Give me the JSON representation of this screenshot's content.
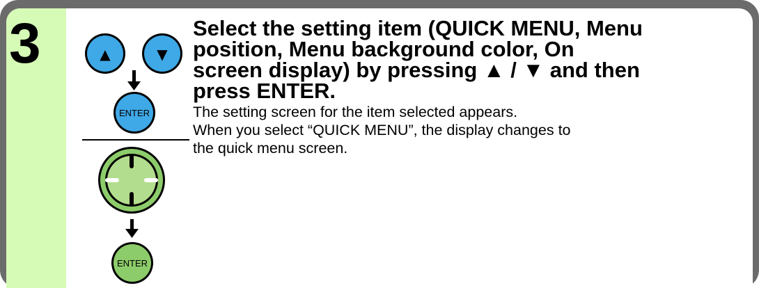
{
  "step": {
    "number": "3"
  },
  "buttons": {
    "up_symbol": "▲",
    "down_symbol": "▼",
    "enter_label_1": "ENTER",
    "enter_label_2": "ENTER"
  },
  "instruction": {
    "heading_lines": [
      "Select the setting item (QUICK MENU, Menu",
      "position, Menu background color, On",
      "screen display) by pressing ▲ / ▼ and then",
      "press ENTER."
    ],
    "body_lines": [
      "The setting screen for the item selected appears.",
      "When you select “QUICK MENU”, the display changes to",
      "the quick menu screen."
    ]
  },
  "colors": {
    "frame": "#6b6b6b",
    "stripe": "#d6fbb6",
    "blue_button": "#3fa8e6",
    "green_button": "#8dcc6a",
    "dpad_outer": "#8dcc6a",
    "dpad_inner": "#b3dd8e"
  },
  "icons": {
    "up": "up-arrow-button-icon",
    "down": "down-arrow-button-icon",
    "enter_blue": "enter-button-icon",
    "dpad": "directional-pad-icon",
    "enter_green": "enter-button-icon"
  }
}
